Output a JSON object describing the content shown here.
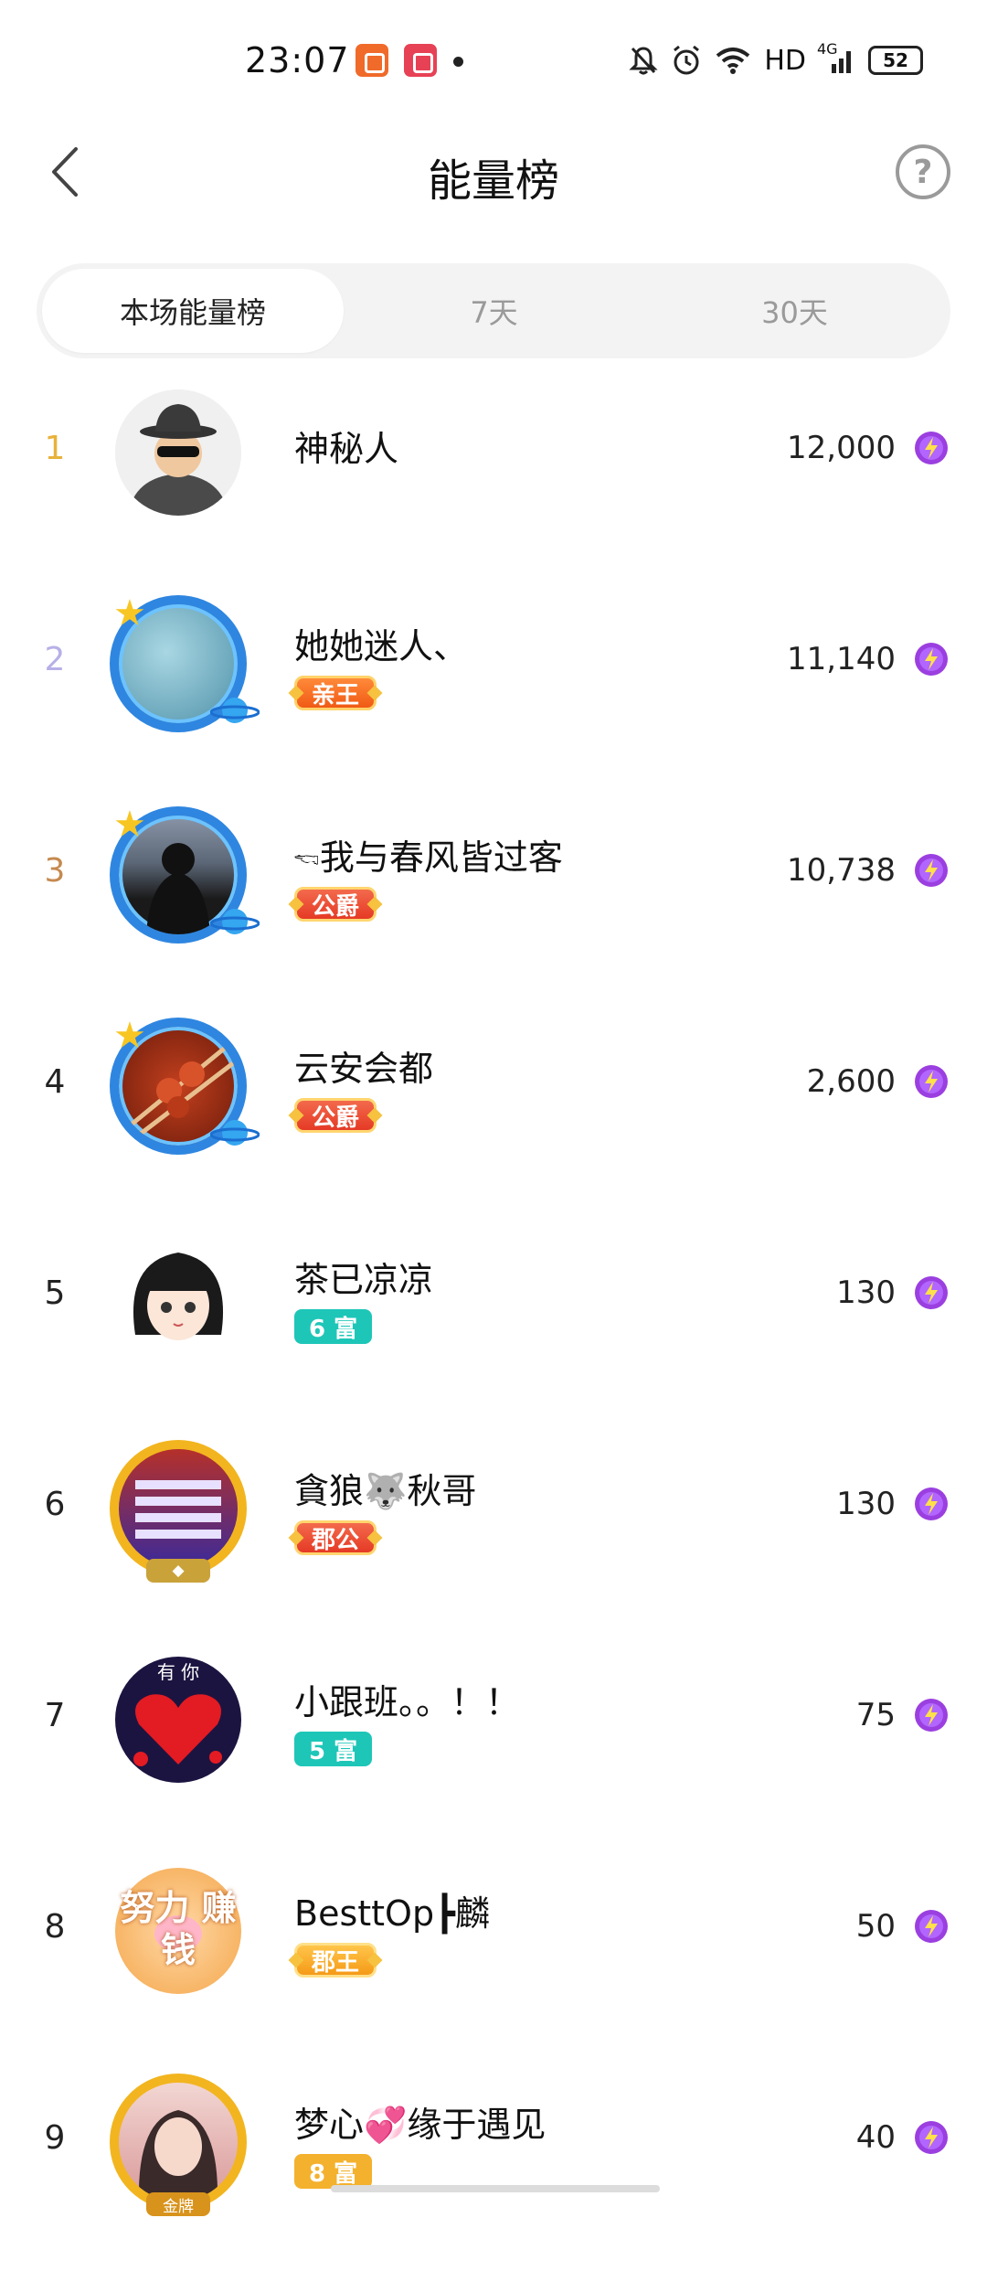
{
  "status_bar": {
    "time": "23:07",
    "network_label": "HD",
    "signal_label": "4G",
    "battery": "52"
  },
  "header": {
    "title": "能量榜",
    "help_label": "?"
  },
  "tabs": [
    {
      "label": "本场能量榜",
      "active": true
    },
    {
      "label": "7天",
      "active": false
    },
    {
      "label": "30天",
      "active": false
    }
  ],
  "ranking": [
    {
      "rank": "1",
      "name": "神秘人",
      "badge": "",
      "score": "12,000"
    },
    {
      "rank": "2",
      "name": "她她迷人、",
      "badge": "亲王",
      "score": "11,140"
    },
    {
      "rank": "3",
      "name": "🖘我与春风皆过客",
      "badge": "公爵",
      "score": "10,738"
    },
    {
      "rank": "4",
      "name": "云安会都",
      "badge": "公爵",
      "score": "2,600"
    },
    {
      "rank": "5",
      "name": "茶已凉凉",
      "badge": "6 富",
      "score": "130"
    },
    {
      "rank": "6",
      "name": "貪狼🐺秋哥",
      "badge": "郡公",
      "score": "130"
    },
    {
      "rank": "7",
      "name": "小跟班。。！！",
      "badge": "5 富",
      "score": "75"
    },
    {
      "rank": "8",
      "name": "BesttOp┣麟",
      "badge": "郡王",
      "score": "50"
    },
    {
      "rank": "9",
      "name": "梦心💞缘于遇见",
      "badge": "8 富",
      "score": "40"
    }
  ],
  "avatar_texts": {
    "row6_frame": "",
    "row7_text": "有 你",
    "row8_text": "努力 赚钱",
    "row9_frame": "金牌"
  }
}
